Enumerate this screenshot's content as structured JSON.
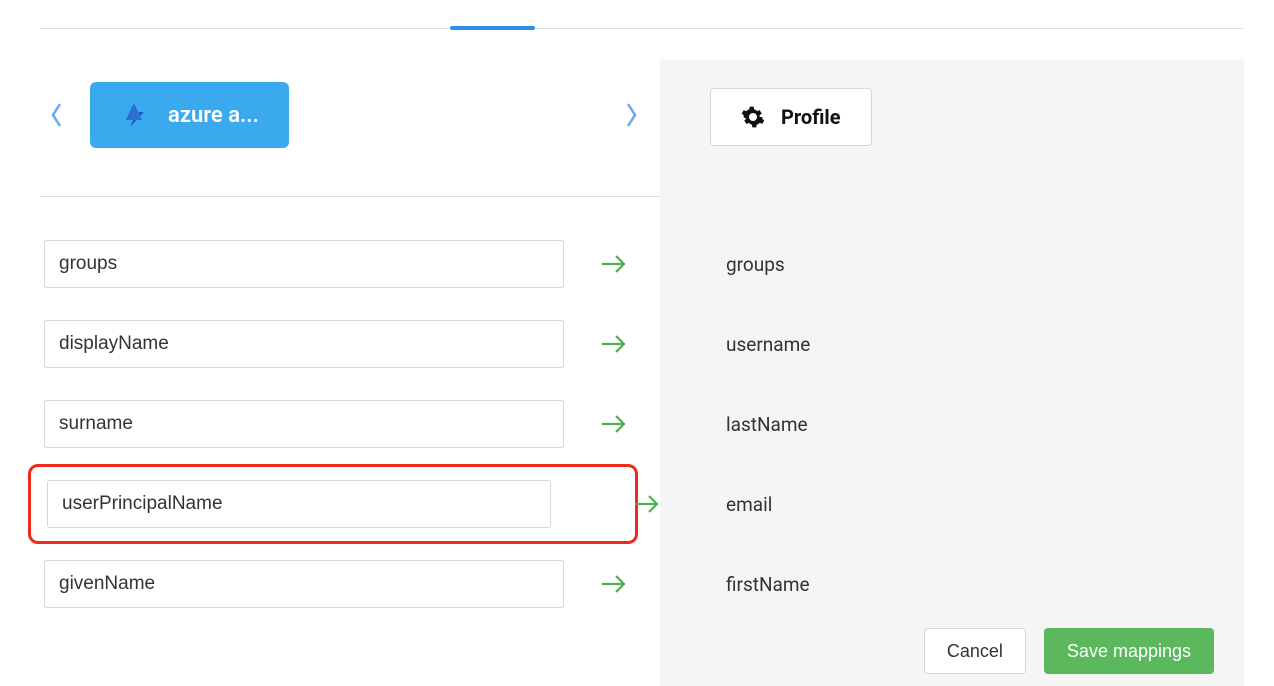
{
  "source": {
    "label": "azure a..."
  },
  "target": {
    "label": "Profile"
  },
  "mappings": [
    {
      "source": "groups",
      "target": "groups",
      "highlight": false
    },
    {
      "source": "displayName",
      "target": "username",
      "highlight": false
    },
    {
      "source": "surname",
      "target": "lastName",
      "highlight": false
    },
    {
      "source": "userPrincipalName",
      "target": "email",
      "highlight": true
    },
    {
      "source": "givenName",
      "target": "firstName",
      "highlight": false
    }
  ],
  "footer": {
    "cancel": "Cancel",
    "save": "Save mappings"
  }
}
